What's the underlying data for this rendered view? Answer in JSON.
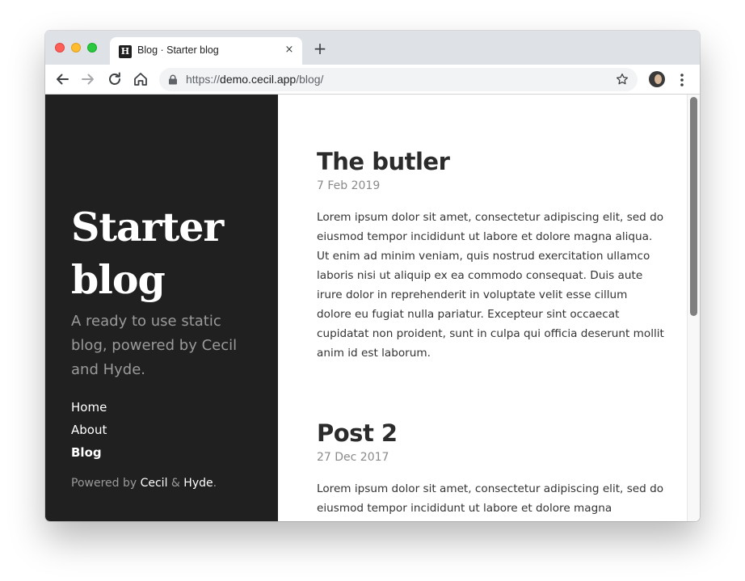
{
  "browser": {
    "tab": {
      "favicon_letter": "H",
      "title": "Blog · Starter blog",
      "close_glyph": "×"
    },
    "new_tab_glyph": "+",
    "toolbar": {
      "back_icon": "arrow-left-icon",
      "forward_icon": "arrow-right-icon",
      "reload_icon": "reload-icon",
      "home_icon": "home-icon",
      "bookmark_icon": "star-icon",
      "menu_icon": "kebab-menu-icon"
    },
    "url": {
      "scheme": "https://",
      "host": "demo.cecil.app",
      "path": "/blog/"
    }
  },
  "sidebar": {
    "title": "Starter blog",
    "lead": "A ready to use static blog, powered by Cecil and Hyde.",
    "nav": [
      {
        "label": "Home",
        "active": false
      },
      {
        "label": "About",
        "active": false
      },
      {
        "label": "Blog",
        "active": true
      }
    ],
    "footer": {
      "prefix": "Powered by ",
      "link1": "Cecil",
      "separator": " & ",
      "link2": "Hyde",
      "suffix": "."
    }
  },
  "posts": [
    {
      "title": "The butler",
      "date": "7 Feb 2019",
      "excerpt": "Lorem ipsum dolor sit amet, consectetur adipiscing elit, sed do eiusmod tempor incididunt ut labore et dolore magna aliqua. Ut enim ad minim veniam, quis nostrud exercitation ullamco laboris nisi ut aliquip ex ea commodo consequat. Duis aute irure dolor in reprehenderit in voluptate velit esse cillum dolore eu fugiat nulla pariatur. Excepteur sint occaecat cupidatat non proident, sunt in culpa qui officia deserunt mollit anim id est laborum."
    },
    {
      "title": "Post 2",
      "date": "27 Dec 2017",
      "excerpt": "Lorem ipsum dolor sit amet, consectetur adipiscing elit, sed do eiusmod tempor incididunt ut labore et dolore magna"
    }
  ],
  "colors": {
    "sidebar_bg": "#202020",
    "sidebar_muted": "#9a9a9a",
    "heading": "#2b2b2b",
    "date": "#8a8a8a",
    "body": "#333333",
    "tabstrip_bg": "#dee1e6"
  }
}
